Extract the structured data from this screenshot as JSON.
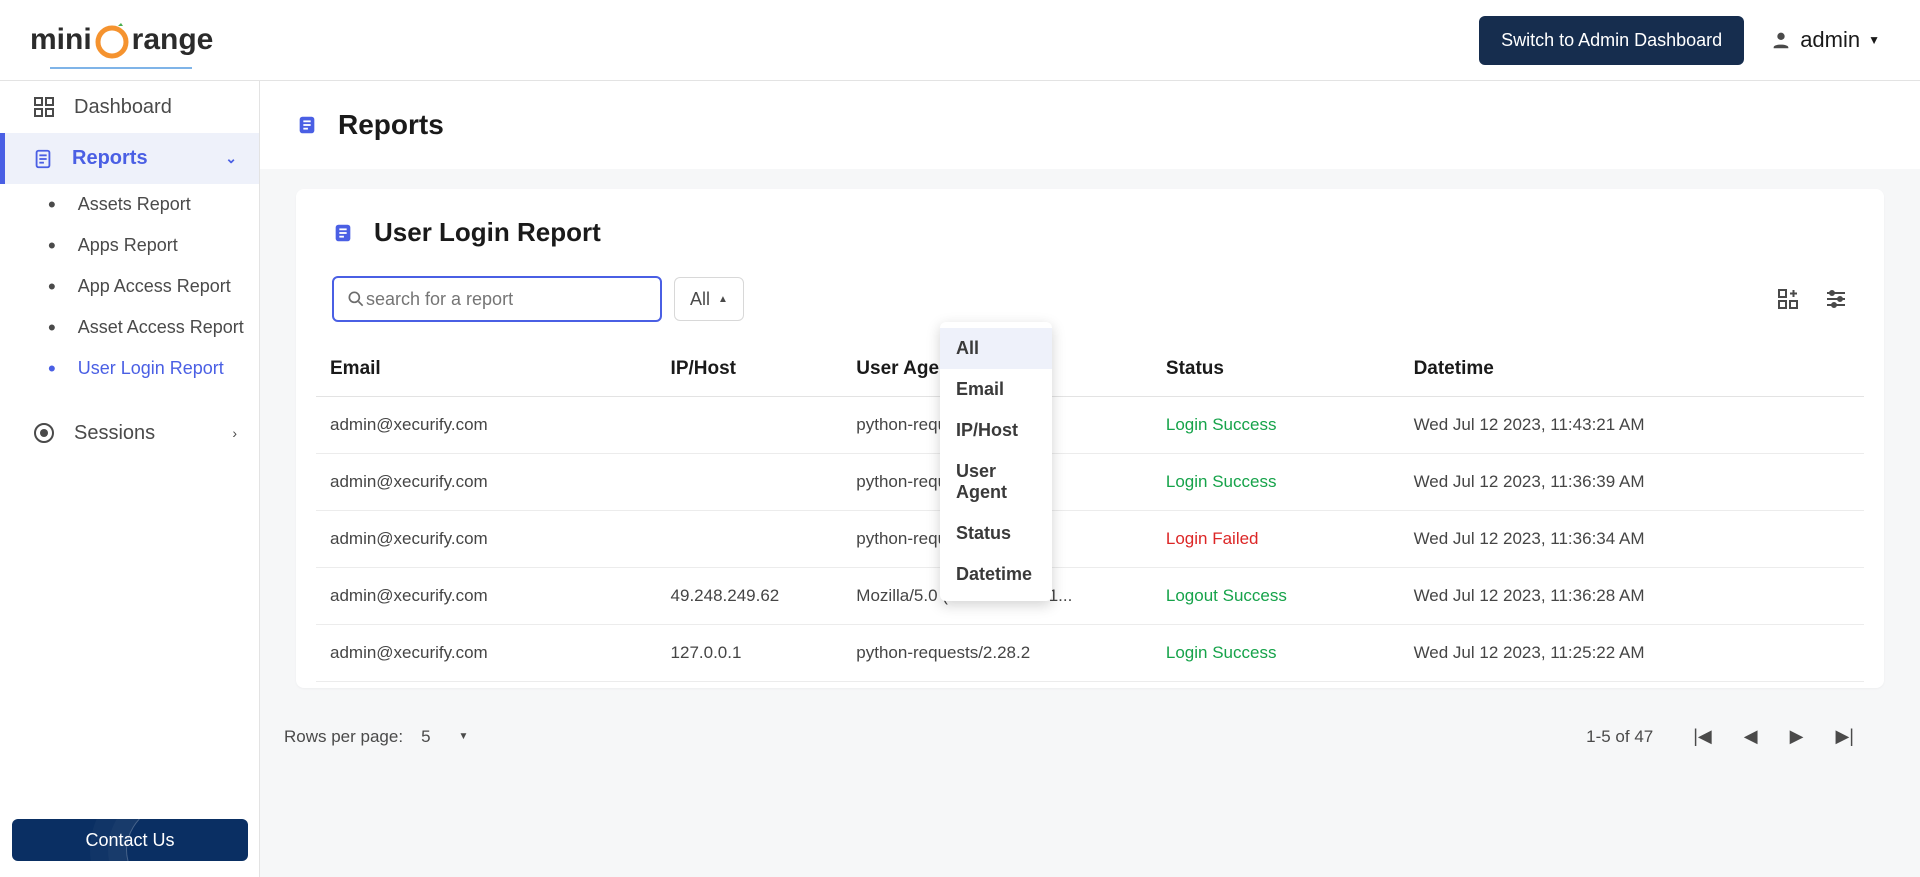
{
  "header": {
    "brand_prefix": "mini",
    "brand_suffix": "range",
    "switch_label": "Switch to Admin Dashboard",
    "user_label": "admin"
  },
  "sidebar": {
    "dashboard": "Dashboard",
    "reports": "Reports",
    "sessions": "Sessions",
    "sub": {
      "assets_report": "Assets Report",
      "apps_report": "Apps Report",
      "app_access_report": "App Access Report",
      "asset_access_report": "Asset Access Report",
      "user_login_report": "User Login Report"
    }
  },
  "contact": {
    "label": "Contact Us"
  },
  "page": {
    "title": "Reports",
    "card_title": "User Login Report",
    "search_placeholder": "search for a report",
    "filter_selected": "All"
  },
  "dropdown_options": {
    "all": "All",
    "email": "Email",
    "iphost": "IP/Host",
    "user_agent": "User Agent",
    "status": "Status",
    "datetime": "Datetime"
  },
  "columns": {
    "email": "Email",
    "iphost": "IP/Host",
    "user_agent": "User Agent",
    "status": "Status",
    "datetime": "Datetime"
  },
  "rows": [
    {
      "email": "admin@xecurify.com",
      "iphost": "",
      "user_agent": "python-requests/2.28.2",
      "status": "Login Success",
      "status_class": "status-success",
      "datetime": "Wed Jul 12 2023, 11:43:21 AM"
    },
    {
      "email": "admin@xecurify.com",
      "iphost": "",
      "user_agent": "python-requests/2.28.2",
      "status": "Login Success",
      "status_class": "status-success",
      "datetime": "Wed Jul 12 2023, 11:36:39 AM"
    },
    {
      "email": "admin@xecurify.com",
      "iphost": "",
      "user_agent": "python-requests/2.28.2",
      "status": "Login Failed",
      "status_class": "status-failed",
      "datetime": "Wed Jul 12 2023, 11:36:34 AM"
    },
    {
      "email": "admin@xecurify.com",
      "iphost": "49.248.249.62",
      "user_agent": "Mozilla/5.0 (Windows NT 1...",
      "status": "Logout Success",
      "status_class": "status-success",
      "datetime": "Wed Jul 12 2023, 11:36:28 AM"
    },
    {
      "email": "admin@xecurify.com",
      "iphost": "127.0.0.1",
      "user_agent": "python-requests/2.28.2",
      "status": "Login Success",
      "status_class": "status-success",
      "datetime": "Wed Jul 12 2023, 11:25:22 AM"
    }
  ],
  "pager": {
    "rows_label": "Rows per page:",
    "rows_value": "5",
    "range_text": "1-5 of 47"
  }
}
